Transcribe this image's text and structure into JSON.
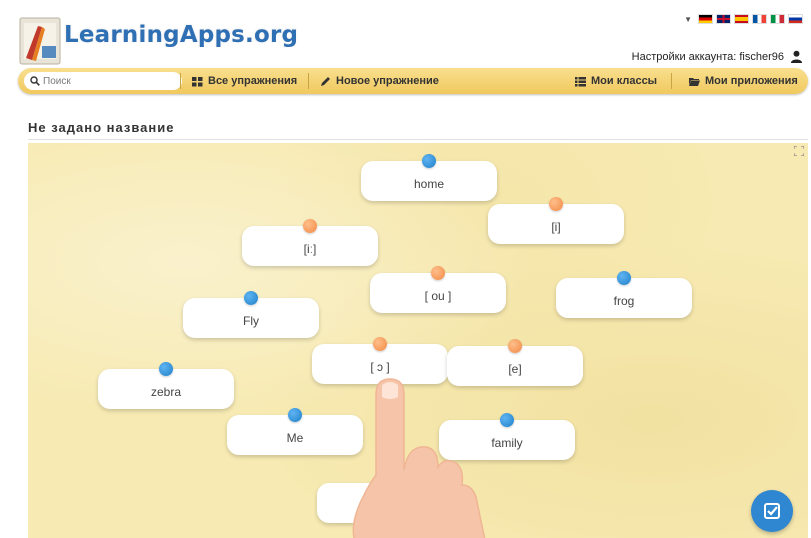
{
  "header": {
    "logo_text": "LearningApps.org",
    "account_label": "Настройки аккаунта: fischer96"
  },
  "navbar": {
    "search_placeholder": "Поиск",
    "items": [
      {
        "label": "Все упражнения",
        "icon": "grid-icon"
      },
      {
        "label": "Новое упражнение",
        "icon": "pencil-icon"
      },
      {
        "label": "Мои классы",
        "icon": "list-icon"
      },
      {
        "label": "Мои приложения",
        "icon": "folder-icon"
      }
    ]
  },
  "page": {
    "title": "Не задано название"
  },
  "app": {
    "cards": [
      {
        "text": "home",
        "pin": "blue"
      },
      {
        "text": "[i]",
        "pin": "orange"
      },
      {
        "text": "[iː]",
        "pin": "orange"
      },
      {
        "text": "[ ou ]",
        "pin": "orange"
      },
      {
        "text": "frog",
        "pin": "blue"
      },
      {
        "text": "Fly",
        "pin": "blue"
      },
      {
        "text": "[ ɔ ]",
        "pin": "orange"
      },
      {
        "text": "[e]",
        "pin": "orange"
      },
      {
        "text": "zebra",
        "pin": "blue"
      },
      {
        "text": "Me",
        "pin": "blue"
      },
      {
        "text": "family",
        "pin": "blue"
      },
      {
        "text": "",
        "pin": "none"
      }
    ],
    "pin_colors": {
      "blue": "#2585d0",
      "orange": "#f28c48"
    },
    "background_color": "#f7eab2"
  },
  "colors": {
    "navbar": "#f3cf6a",
    "logo": "#2f6fb3",
    "check_button": "#2f86d1"
  }
}
